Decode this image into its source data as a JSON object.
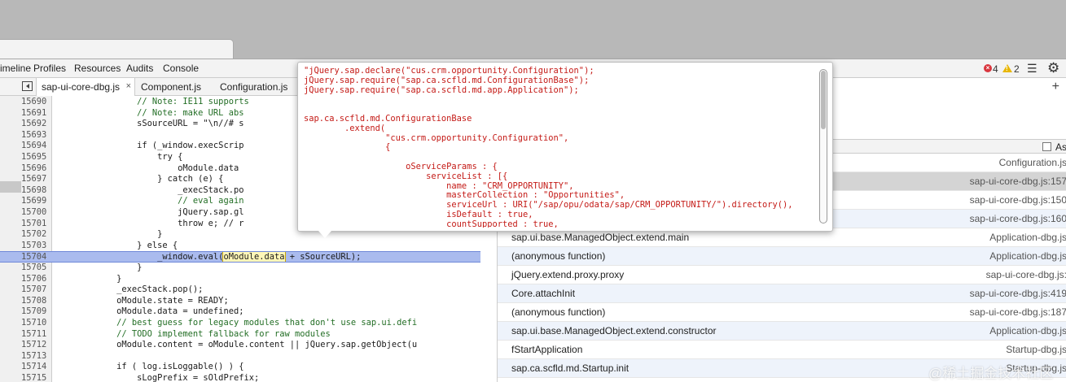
{
  "panel_tabs": [
    "imeline",
    "Profiles",
    "Resources",
    "Audits",
    "Console"
  ],
  "status": {
    "errors": "4",
    "warnings": "2"
  },
  "file_tabs": [
    {
      "label": "sap-ui-core-dbg.js",
      "close": "×"
    },
    {
      "label": "Component.js"
    },
    {
      "label": "Configuration.js"
    }
  ],
  "code": {
    "lines": [
      {
        "n": "15690",
        "text": "                // Note: IE11 supports"
      },
      {
        "n": "15691",
        "text": "                // Note: make URL abs"
      },
      {
        "n": "15692",
        "text": "                sSourceURL = \"\\n//# s"
      },
      {
        "n": "15693",
        "text": ""
      },
      {
        "n": "15694",
        "text": "                if (_window.execScrip"
      },
      {
        "n": "15695",
        "text": "                    try {"
      },
      {
        "n": "15696",
        "text": "                        oModule.data"
      },
      {
        "n": "15697",
        "text": "                    } catch (e) {"
      },
      {
        "n": "15698",
        "text": "                        _execStack.po"
      },
      {
        "n": "15699",
        "text": "                        // eval again"
      },
      {
        "n": "15700",
        "text": "                        jQuery.sap.gl"
      },
      {
        "n": "15701",
        "text": "                        throw e; // r"
      },
      {
        "n": "15702",
        "text": "                    }"
      },
      {
        "n": "15703",
        "text": "                } else {"
      },
      {
        "n": "15704",
        "pre": "                    _window.eval(",
        "boxed": "oModule.data",
        "post": " + sSourceURL);"
      },
      {
        "n": "15705",
        "text": "                }"
      },
      {
        "n": "15706",
        "text": "            }"
      },
      {
        "n": "15707",
        "text": "            _execStack.pop();"
      },
      {
        "n": "15708",
        "text": "            oModule.state = READY;"
      },
      {
        "n": "15709",
        "text": "            oModule.data = undefined;"
      },
      {
        "n": "15710",
        "text": "            // best guess for legacy modules that don't use sap.ui.defi"
      },
      {
        "n": "15711",
        "text": "            // TODO implement fallback for raw modules"
      },
      {
        "n": "15712",
        "text": "            oModule.content = oModule.content || jQuery.sap.getObject(u"
      },
      {
        "n": "15713",
        "text": ""
      },
      {
        "n": "15714",
        "text": "            if ( log.isLoggable() ) {"
      },
      {
        "n": "15715",
        "text": "                sLogPrefix = sOldPrefix;"
      }
    ]
  },
  "popover": {
    "lines": [
      "\"jQuery.sap.declare(\"cus.crm.opportunity.Configuration\");",
      "jQuery.sap.require(\"sap.ca.scfld.md.ConfigurationBase\");",
      "jQuery.sap.require(\"sap.ca.scfld.md.app.Application\");",
      "",
      "",
      "sap.ca.scfld.md.ConfigurationBase",
      "        .extend(",
      "                \"cus.crm.opportunity.Configuration\",",
      "                {",
      "",
      "                    oServiceParams : {",
      "                        serviceList : [{",
      "                            name : \"CRM_OPPORTUNITY\",",
      "                            masterCollection : \"Opportunities\",",
      "                            serviceUrl : URI(\"/sap/opu/odata/sap/CRM_OPPORTUNITY/\").directory(),",
      "                            isDefault : true,",
      "                            countSupported : true,"
    ]
  },
  "async_label": "Async",
  "call_stack": [
    {
      "fn": "",
      "loc": "Configuration.js"
    },
    {
      "fn": "",
      "loc": "sap-ui-core-dbg.js:157"
    },
    {
      "fn": "",
      "loc": "sap-ui-core-dbg.js:150"
    },
    {
      "fn": "",
      "loc": "sap-ui-core-dbg.js:160"
    },
    {
      "fn": "sap.ui.base.ManagedObject.extend.main",
      "loc": "Application-dbg.js"
    },
    {
      "fn": "(anonymous function)",
      "loc": "Application-dbg.js"
    },
    {
      "fn": "jQuery.extend.proxy.proxy",
      "loc": "sap-ui-core-dbg.js:"
    },
    {
      "fn": "Core.attachInit",
      "loc": "sap-ui-core-dbg.js:419"
    },
    {
      "fn": "(anonymous function)",
      "loc": "sap-ui-core-dbg.js:187"
    },
    {
      "fn": "sap.ui.base.ManagedObject.extend.constructor",
      "loc": "Application-dbg.js"
    },
    {
      "fn": "fStartApplication",
      "loc": "Startup-dbg.js"
    },
    {
      "fn": "sap.ca.scfld.md.Startup.init",
      "loc": "Startup-dbg.js"
    }
  ],
  "watermark": "@稀土掘金技术社区"
}
